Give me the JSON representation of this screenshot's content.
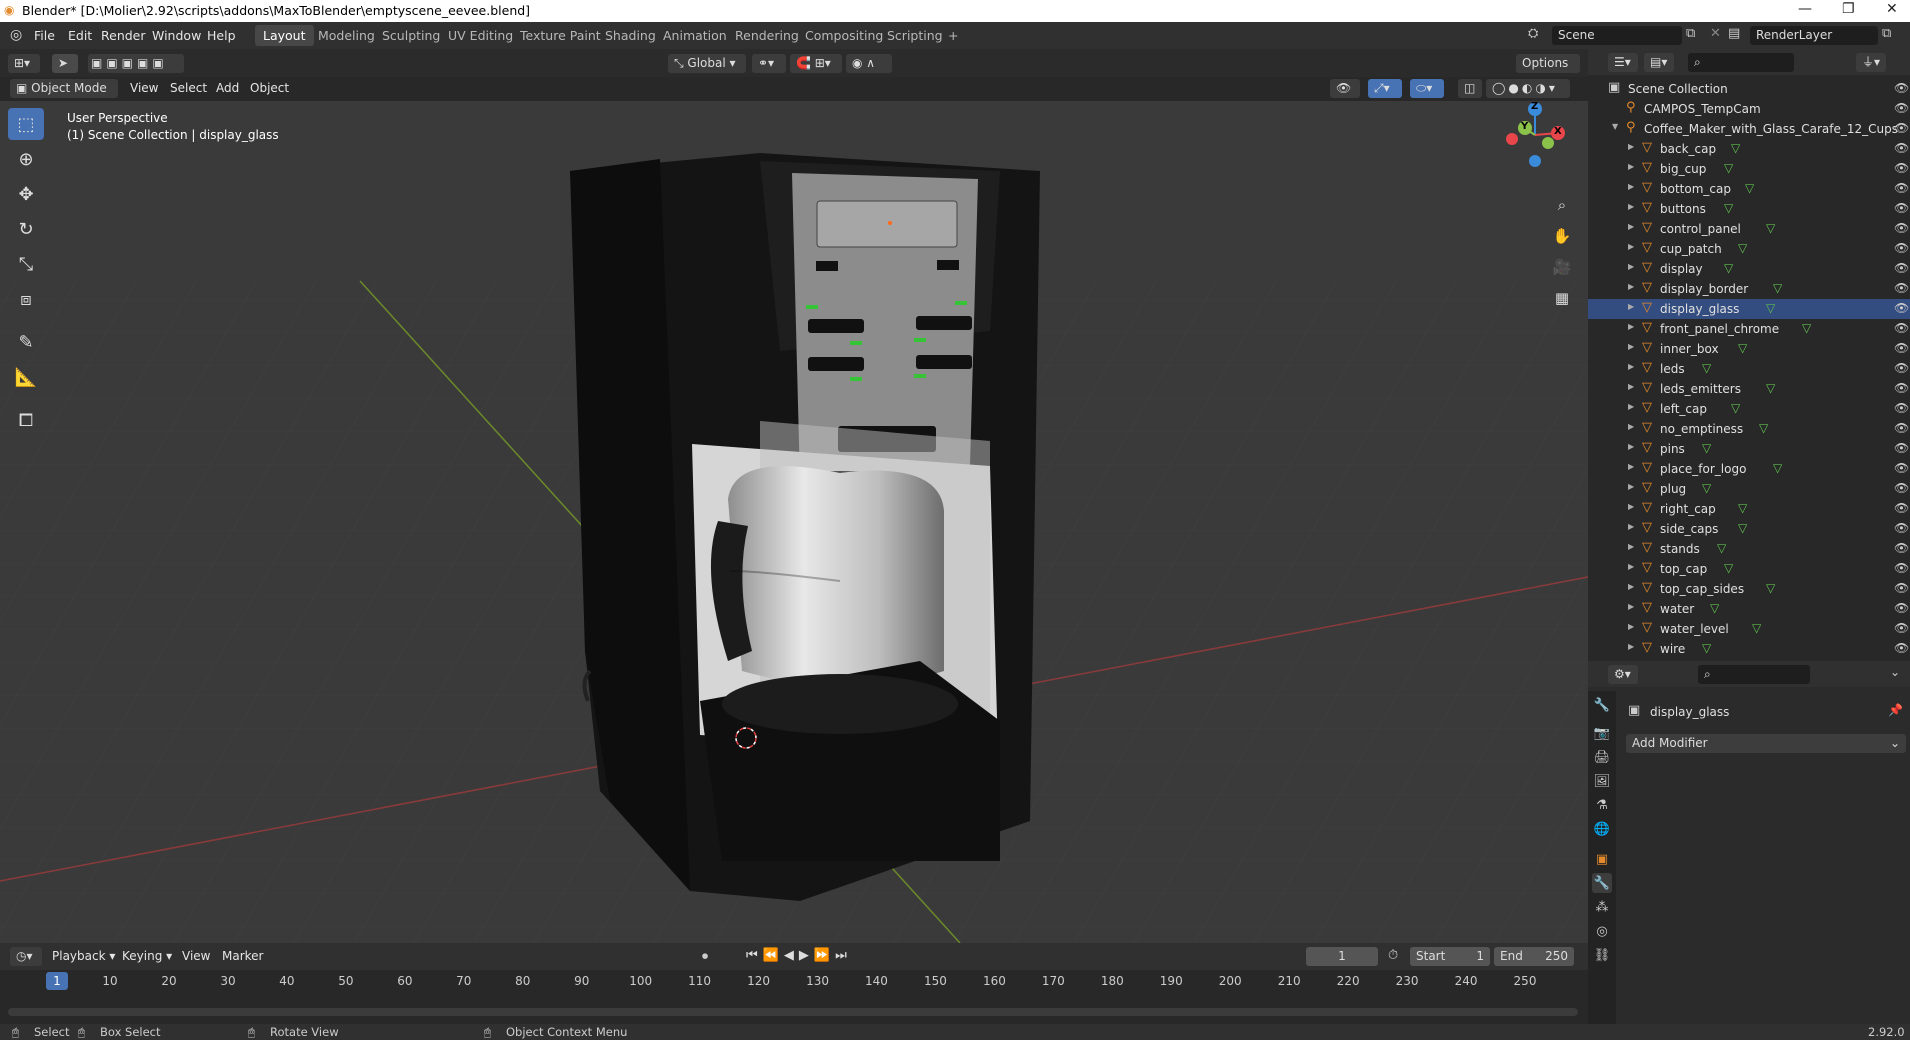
{
  "window": {
    "title": "Blender* [D:\\Molier\\2.92\\scripts\\addons\\MaxToBlender\\emptyscene_eevee.blend]",
    "controls": [
      "—",
      "❐",
      "✕"
    ]
  },
  "menu": [
    "File",
    "Edit",
    "Render",
    "Window",
    "Help"
  ],
  "workspaces": [
    {
      "label": "Layout",
      "active": true
    },
    {
      "label": "Modeling"
    },
    {
      "label": "Sculpting"
    },
    {
      "label": "UV Editing"
    },
    {
      "label": "Texture Paint"
    },
    {
      "label": "Shading"
    },
    {
      "label": "Animation"
    },
    {
      "label": "Rendering"
    },
    {
      "label": "Compositing"
    },
    {
      "label": "Scripting"
    }
  ],
  "add_workspace": "+",
  "scene": {
    "name": "Scene",
    "view_layer": "RenderLayer"
  },
  "viewport_header": {
    "orientation": "Global",
    "options": "Options"
  },
  "viewport_menu": {
    "mode": "Object Mode",
    "items": [
      "View",
      "Select",
      "Add",
      "Object"
    ]
  },
  "viewport_info": {
    "line1": "User Perspective",
    "line2": "(1) Scene Collection | display_glass"
  },
  "gizmo": {
    "x": "X",
    "y": "Y",
    "z": "Z"
  },
  "outliner": {
    "root": "Scene Collection",
    "camera": "CAMPOS_TempCam",
    "group": "Coffee_Maker_with_Glass_Carafe_12_Cups",
    "items": [
      "back_cap",
      "big_cup",
      "bottom_cap",
      "buttons",
      "control_panel",
      "cup_patch",
      "display",
      "display_border",
      "display_glass",
      "front_panel_chrome",
      "inner_box",
      "leds",
      "leds_emitters",
      "left_cap",
      "no_emptiness",
      "pins",
      "place_for_logo",
      "plug",
      "right_cap",
      "side_caps",
      "stands",
      "top_cap",
      "top_cap_sides",
      "water",
      "water_level",
      "wire"
    ],
    "selected": "display_glass"
  },
  "properties": {
    "object": "display_glass",
    "add_modifier": "Add Modifier"
  },
  "timeline": {
    "menu": [
      "Playback",
      "Keying",
      "View",
      "Marker"
    ],
    "current_frame": "1",
    "start_label": "Start",
    "start": "1",
    "end_label": "End",
    "end": "250",
    "ticks": [
      "1",
      "10",
      "20",
      "30",
      "40",
      "50",
      "60",
      "70",
      "80",
      "90",
      "100",
      "110",
      "120",
      "130",
      "140",
      "150",
      "160",
      "170",
      "180",
      "190",
      "200",
      "210",
      "220",
      "230",
      "240",
      "250"
    ]
  },
  "status": {
    "select": "Select",
    "box_select": "Box Select",
    "rotate": "Rotate View",
    "context": "Object Context Menu",
    "version": "2.92.0"
  },
  "colors": {
    "accent": "#4772b3",
    "object_orange": "#e38a2c",
    "mesh_green": "#5fbf4f",
    "axis_x": "#e8464a",
    "axis_y": "#8bc34a",
    "axis_z": "#3b8bdb"
  }
}
